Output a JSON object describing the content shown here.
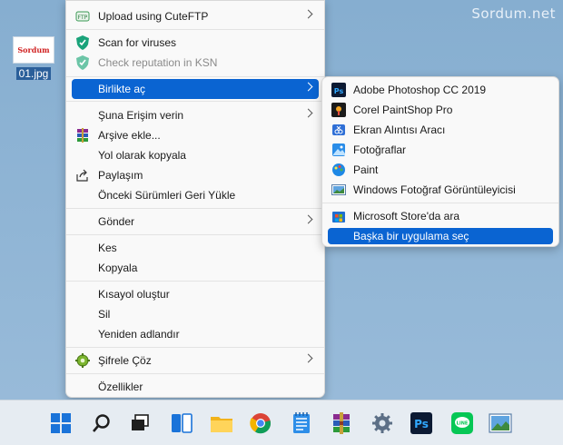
{
  "desktop": {
    "watermark": "Sordum.net",
    "file": {
      "name": "01.jpg",
      "thumb_text": "Sordum"
    }
  },
  "context_menu": {
    "items": [
      {
        "label": "Upload using CuteFTP",
        "icon": "cuteftp-icon",
        "submenu": true
      },
      {
        "label": "Scan for viruses",
        "icon": "kaspersky-shield-icon"
      },
      {
        "label": "Check reputation in KSN",
        "icon": "kaspersky-shield-icon",
        "disabled": true
      },
      {
        "label": "Birlikte aç",
        "submenu": true,
        "highlighted": true
      },
      {
        "label": "Şuna Erişim verin",
        "submenu": true
      },
      {
        "label": "Arşive ekle...",
        "icon": "winrar-icon"
      },
      {
        "label": "Yol olarak kopyala"
      },
      {
        "label": "Paylaşım",
        "icon": "share-icon"
      },
      {
        "label": "Önceki Sürümleri Geri Yükle"
      },
      {
        "label": "Gönder",
        "submenu": true
      },
      {
        "label": "Kes"
      },
      {
        "label": "Kopyala"
      },
      {
        "label": "Kısayol oluştur"
      },
      {
        "label": "Sil"
      },
      {
        "label": "Yeniden adlandır"
      },
      {
        "label": "Şifrele Çöz",
        "icon": "encrypt-gear-icon",
        "submenu": true
      },
      {
        "label": "Özellikler"
      }
    ]
  },
  "open_with_submenu": {
    "items": [
      {
        "label": "Adobe Photoshop CC 2019",
        "icon": "photoshop-icon"
      },
      {
        "label": "Corel PaintShop Pro",
        "icon": "paintshop-icon"
      },
      {
        "label": "Ekran Alıntısı Aracı",
        "icon": "snipping-tool-icon"
      },
      {
        "label": "Fotoğraflar",
        "icon": "photos-icon"
      },
      {
        "label": "Paint",
        "icon": "paint-icon"
      },
      {
        "label": "Windows Fotoğraf Görüntüleyicisi",
        "icon": "photo-viewer-icon"
      },
      {
        "label": "Microsoft Store'da ara",
        "icon": "store-icon"
      },
      {
        "label": "Başka bir uygulama seç",
        "highlighted": true
      }
    ]
  },
  "taskbar": {
    "apps": [
      "start-icon",
      "search-icon",
      "task-view-icon",
      "widgets-icon",
      "file-explorer-icon",
      "chrome-icon",
      "notepad-icon",
      "winrar-icon",
      "settings-icon",
      "photoshop-icon",
      "line-icon",
      "photo-viewer-icon"
    ]
  },
  "colors": {
    "accent": "#0a64d2",
    "menu_bg": "#f9f9f9",
    "desktop_bg": "#8fb3d3"
  }
}
